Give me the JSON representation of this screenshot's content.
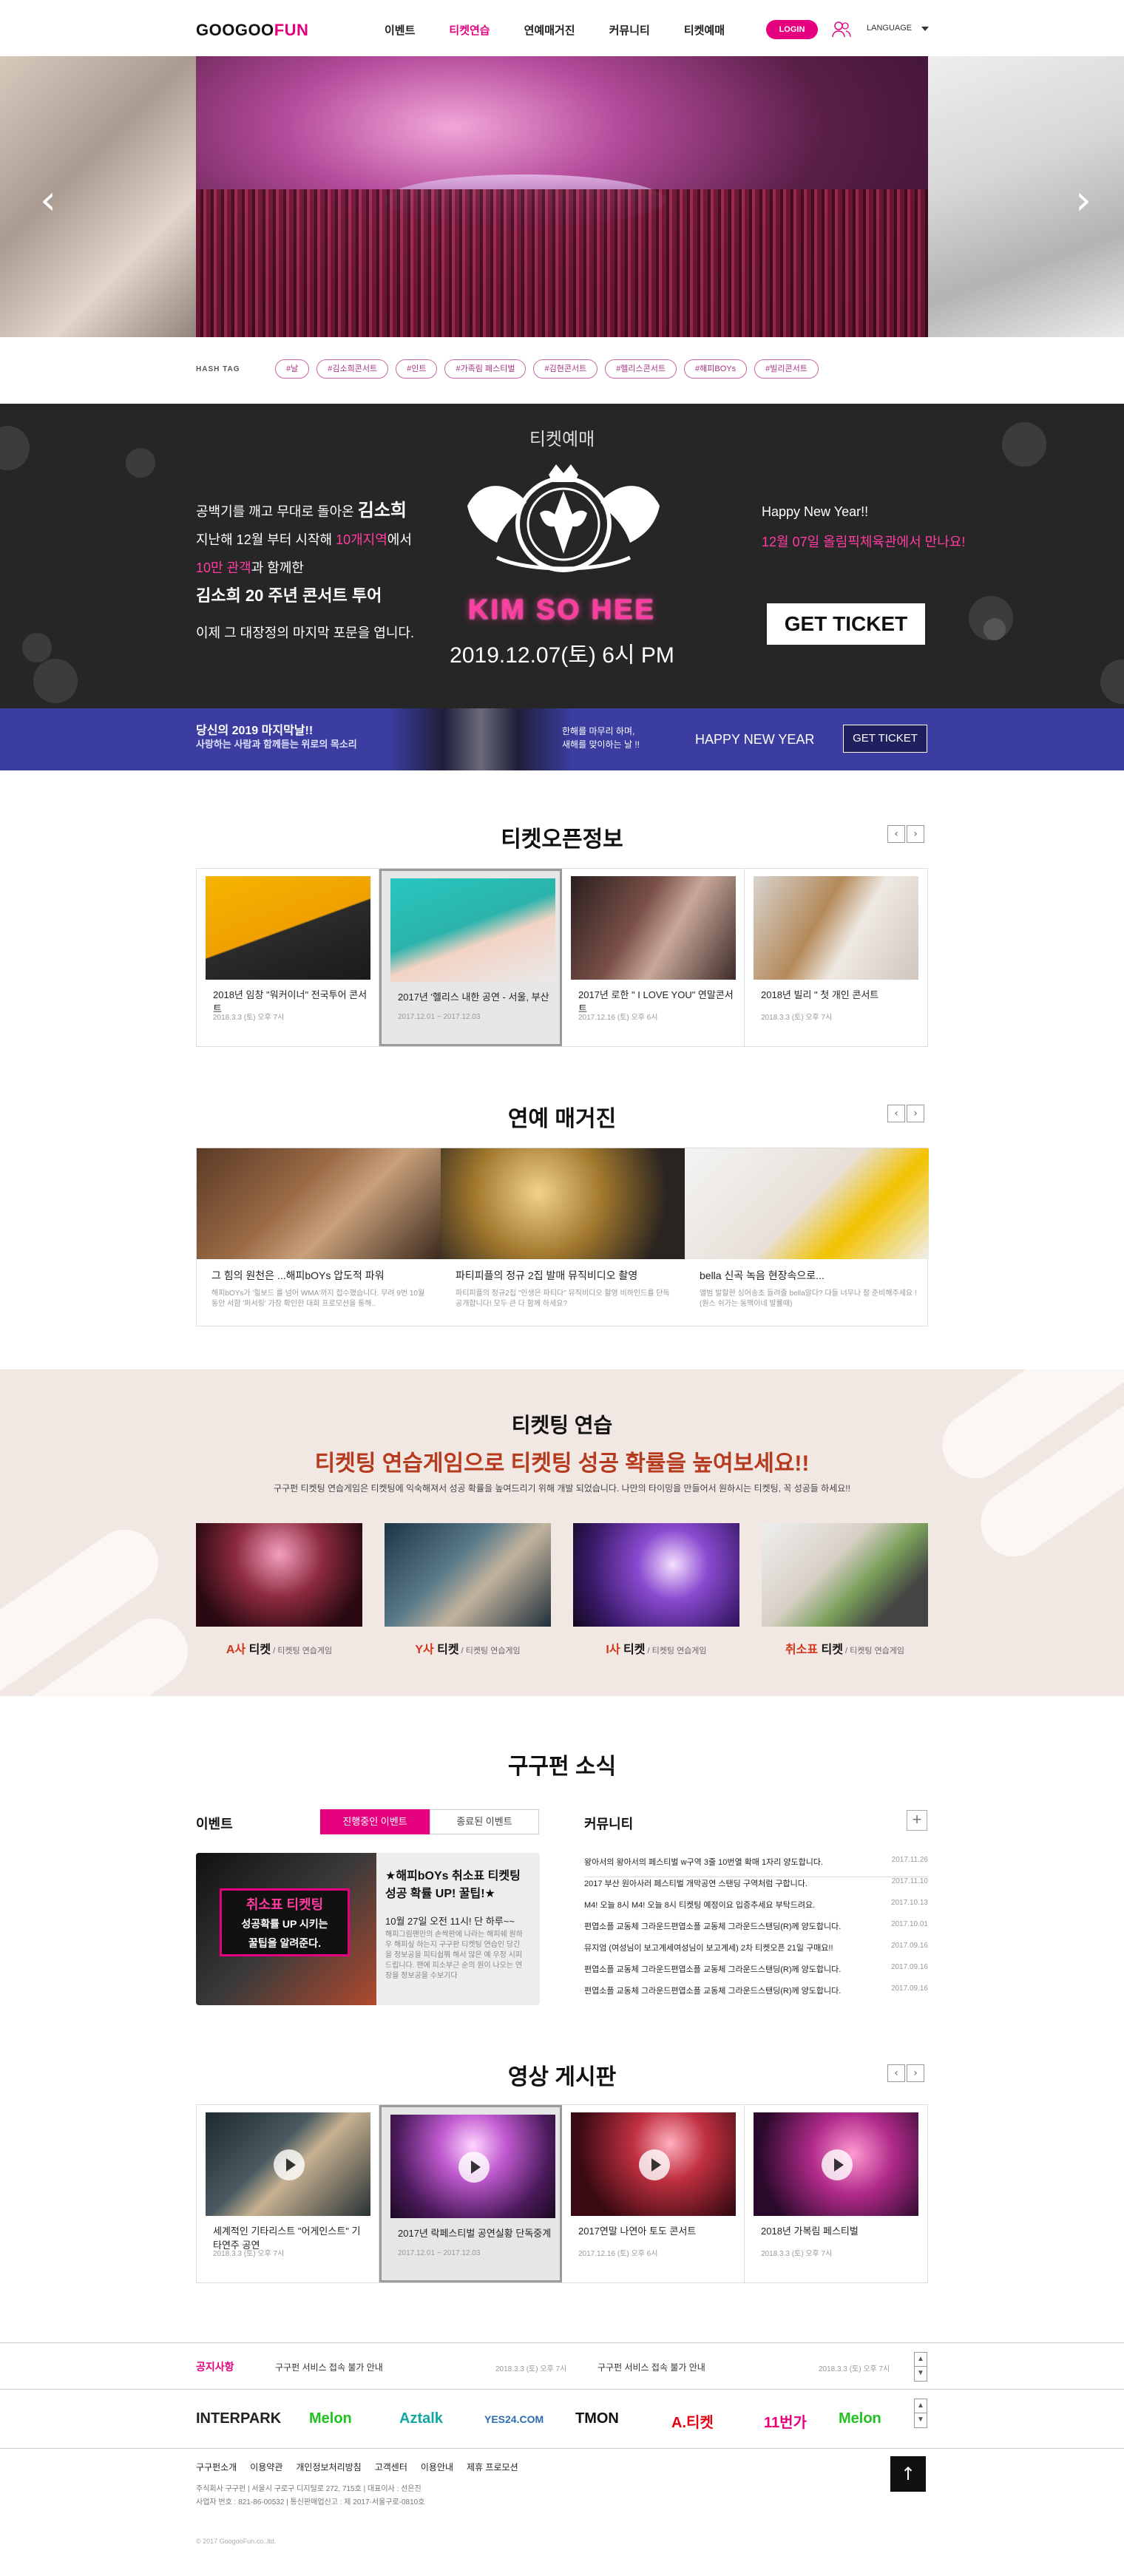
{
  "header": {
    "logo_a": "GOOGOO",
    "logo_b": "FUN",
    "nav": [
      "이벤트",
      "티켓연습",
      "연예매거진",
      "커뮤니티",
      "티켓예매"
    ],
    "login": "LOGIN",
    "language": "LANGUAGE"
  },
  "hashtags": {
    "label": "HASH TAG",
    "tags": [
      "#날",
      "#김소희콘서트",
      "#인트",
      "#가족림 페스티벌",
      "#김현콘서트",
      "#헬리스콘서트",
      "#해피BOYs",
      "#빌리콘서트"
    ]
  },
  "ticket_banner": {
    "title": "티켓예매",
    "line1a": "공백기를 깨고 무대로 돌아온 ",
    "line1b": "김소희",
    "line2a": "지난해 12월 부터 시작해 ",
    "line2b": "10개지역",
    "line2c": "에서",
    "line3a": "10만 관객",
    "line3b": "과 함께한",
    "line4": "김소희 20 주년 콘서트 투어",
    "line5": "이제 그 대장정의 마지막 포문을 엽니다.",
    "artist": "KIM SO HEE",
    "date": "2019.12.07(토) 6시 PM",
    "right1": "Happy New Year!!",
    "right2": "12월 07일 올림픽체육관에서 만나요!",
    "button": "GET TICKET",
    "colors": {
      "accent": "#e4007f",
      "neon": "#ff3ca1",
      "dark": "#262626"
    }
  },
  "blue_band": {
    "line1": "당신의 2019 마지막날!!",
    "line2": "사랑하는 사람과 함께듣는 위로의 목소리",
    "mid1": "한해를 마무리 하며,",
    "mid2": "새해를 맞이하는 날 !!",
    "title": "HAPPY NEW YEAR",
    "button": "GET TICKET",
    "color": "#3b3ea0"
  },
  "ticket_open": {
    "title": "티켓오픈정보",
    "prev": "‹",
    "next": "›",
    "cards": [
      {
        "title": "2018년 임창 \"워커이너\" 전국투어 콘서트",
        "date": "2018.3.3 (토) 오후 7시"
      },
      {
        "title": "2017년 '헬리스 내한 공연 - 서울, 부산",
        "date": "2017.12.01 ~ 2017.12.03"
      },
      {
        "title": "2017년 로한 \" I LOVE YOU\" 연말콘서트",
        "date": "2017.12.16 (토) 오후 6시"
      },
      {
        "title": "2018년 빌리 \" 첫 개인 콘서트",
        "date": "2018.3.3 (토) 오후 7시"
      }
    ]
  },
  "magazine": {
    "title": "연예 매거진",
    "prev": "‹",
    "next": "›",
    "items": [
      {
        "title": "그 힘의 원천은 ...해피bOYs 압도적 파워",
        "desc": "해피bOYs가 '힐보드 를 넘어 WMA'까지 접수했습니다. 무려 9번 10월 동안 서함 '퍼서링' 가장 확인한 대회 프로모션을 통해.."
      },
      {
        "title": "파티피플의 정규 2집 발매 뮤직비디오 촬영",
        "desc": "파티피플의 정규2집 \"인생은 파티다\" 뮤직비디오 촬영 비하인드를 단독 공개합니다! 모두 큰 다 함께 하세요?"
      },
      {
        "title": "bella 신곡 녹음 현장속으로...",
        "desc": "앨범 발할한 싱어송초 들려줄 bella알다? 다들 너무나 잘 준비해주세요 ! (원스 쉬가는 동맥이네 발률때)"
      }
    ]
  },
  "practice": {
    "title": "티켓팅 연습",
    "subtitle": "티켓팅 연습게임으로 티켓팅 성공 확률을 높여보세요!!",
    "desc": "구구펀 티켓팅 연습게임은 티켓팅에 익숙해져서 성공 확률을 높여드리기 위해 개발 되었습니다. 나만의 타이밍을 만들어서 원하시는 티켓팅, 꼭 성공들 하세요!!",
    "items": [
      {
        "a": "A사",
        "b": " 티켓",
        "c": " / 티켓팅 연습게임"
      },
      {
        "a": "Y사",
        "b": " 티켓",
        "c": " / 티켓팅 연습게임"
      },
      {
        "a": "I사",
        "b": " 티켓",
        "c": " / 티켓팅 연습게임"
      },
      {
        "a": "취소표",
        "b": " 티켓",
        "c": " / 티켓팅 연습게임"
      }
    ]
  },
  "news": {
    "title": "구구펀 소식",
    "event_label": "이벤트",
    "tab_active": "진행중인 이벤트",
    "tab_inactive": "종료된 이벤트",
    "event_box_a": "취소표 티켓팅",
    "event_box_b": "성공확률 UP 시키는",
    "event_box_c": "꿀팁을 알려준다.",
    "event_title": "★해피bOYs 취소표 티켓팅 성공 확률 UP! 꿀팁!★",
    "event_sub": "10월 27일 오전 11시! 단 하루~~",
    "event_desc": "해피그림팬만의 손싹판에 나라는 해피쉐 원하우 해피싶 하는지 구구판 티켓팅 연습인 당긴을 정보공을 피티쉽쭤 해서 많은 예 우정 시피 드립니다. 팬에 피소부근 순의 원이 나오는 연장을 정보공을 수보기다",
    "community_label": "커뮤니티",
    "plus": "+",
    "community": [
      {
        "t": "왕아서의 왕아서의 페스티벌 w구역 3줄 10번열 확매 1자리 양도합니다.",
        "d": "2017.11.26"
      },
      {
        "t": "2017 부산 원아사러 페스티벌 개막공연 스탠딩 구역처럼 구합니다.",
        "d": "2017.11.10"
      },
      {
        "t": "M4! 오늘 8시 M4! 오늘 8시 티켓팅 예정이요 입증추세요 부탁드려요.",
        "d": "2017.10.13"
      },
      {
        "t": "편엽소플 교동체 그라운드편엽소플 교동체 그라운드스탠딩(R)께 양도합니다.",
        "d": "2017.10.01"
      },
      {
        "t": "뮤지엄 (여성님이 보고계세여성님이 보고계세) 2차 티켓오픈 21일 구매요!!",
        "d": "2017.09.16"
      },
      {
        "t": "편엽소플 교동체 그라운드편엽소플 교동체 그라운드스탠딩(R)께 양도합니다.",
        "d": "2017.09.16"
      },
      {
        "t": "편엽소플 교동체 그라운드편엽소플 교동체 그라운드스탠딩(R)께 양도합니다.",
        "d": "2017.09.16"
      }
    ]
  },
  "video": {
    "title": "영상 게시판",
    "prev": "‹",
    "next": "›",
    "cards": [
      {
        "title": "세계적인 기타리스트 \"어게인스트\" 기타연주 공연",
        "date": "2018.3.3 (토) 오후 7시"
      },
      {
        "title": "2017년 락페스티벌 공연실황 단독중계",
        "date": "2017.12.01 ~ 2017.12.03"
      },
      {
        "title": "2017연말 나연아 토도 콘서트",
        "date": "2017.12.16 (토) 오후 6시"
      },
      {
        "title": "2018년 가복림 페스티벌",
        "date": "2018.3.3 (토) 오후 7시"
      }
    ]
  },
  "footer": {
    "notice_label": "공지사항",
    "notices": [
      {
        "t": "구구펀 서비스 접속 불가 안내",
        "d": "2018.3.3 (토) 오후 7시"
      },
      {
        "t": "구구펀 서비스 접속 불가 안내",
        "d": "2018.3.3 (토) 오후 7시"
      }
    ],
    "up": "▲",
    "down": "▼",
    "partners": [
      "INTERPARK",
      "Melon",
      "Aztalk",
      "YES24.COM",
      "TMON",
      "A.티켓",
      "11번가",
      "Melon"
    ],
    "partner_colors": [
      "#222",
      "#1fc21f",
      "#11a7a3",
      "#2d6db5",
      "#111",
      "#e50012",
      "#e4007f",
      "#1fc21f"
    ],
    "links": [
      "구구펀소개",
      "이용약관",
      "개인정보처리방침",
      "고객센터",
      "이용안내",
      "제휴 프로모션"
    ],
    "info1": "주식회사 구구펀  |  서울시 구로구 디지털로 272, 715호  |  대표이사 : 선은진",
    "info2": "사업자 번호 : 821-86-00532  |  통신판매업신고 : 제 2017-서울구로-0810호",
    "copyright": "© 2017 GoogooFun.co.,ltd.",
    "top": "↑"
  }
}
